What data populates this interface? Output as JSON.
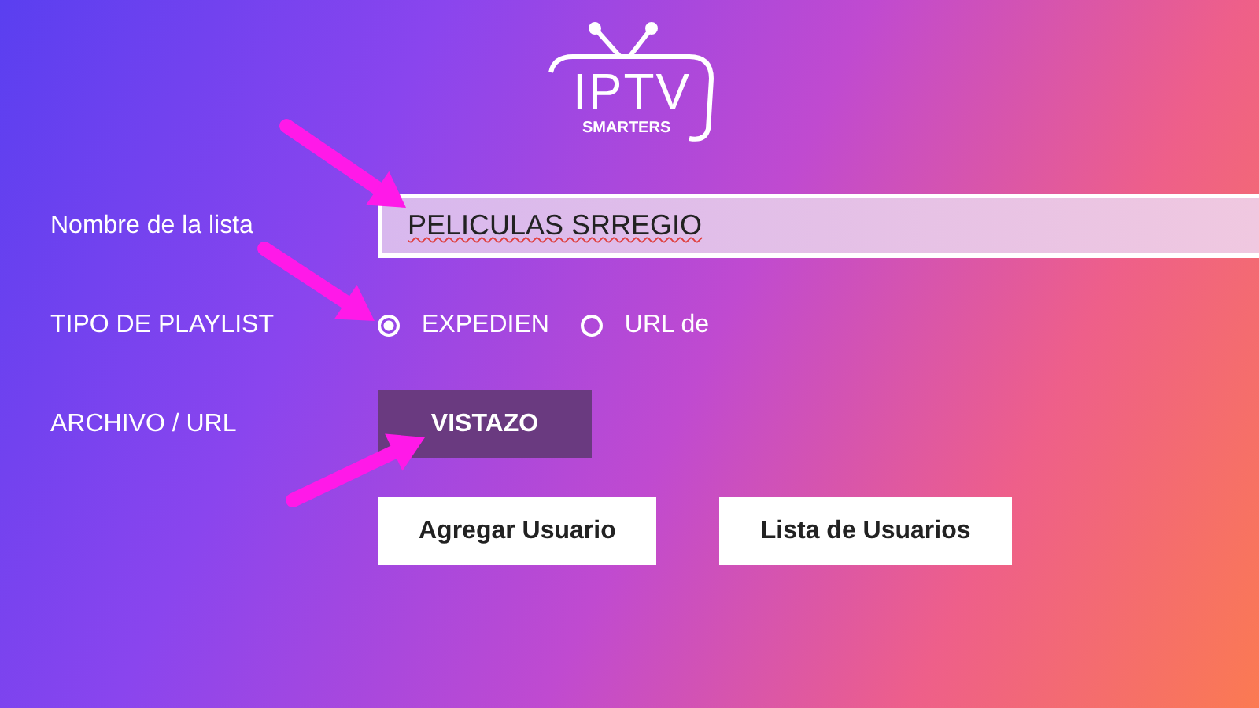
{
  "logo": {
    "title": "IPTV",
    "subtitle": "SMARTERS"
  },
  "form": {
    "rows": [
      {
        "kind": "field",
        "label": "Nombre de la lista",
        "value": "PELICULAS SRREGIO"
      },
      {
        "kind": "radio",
        "label": "TIPO DE PLAYLIST",
        "options": [
          {
            "label": "EXPEDIEN",
            "selected": true
          },
          {
            "label": "URL de",
            "selected": false
          }
        ]
      },
      {
        "kind": "button",
        "label": "ARCHIVO / URL",
        "button": "VISTAZO"
      }
    ]
  },
  "buttons": [
    "Agregar Usuario",
    "Lista de Usuarios"
  ]
}
